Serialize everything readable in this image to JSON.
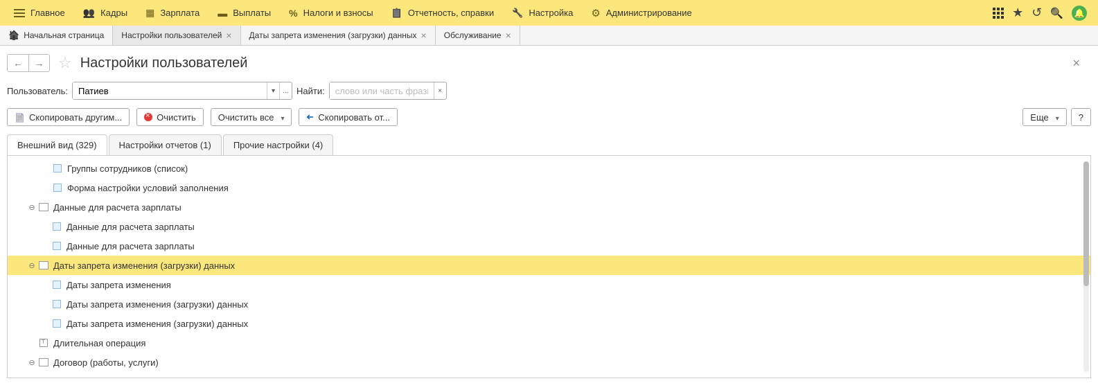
{
  "topMenu": {
    "items": [
      {
        "label": "Главное"
      },
      {
        "label": "Кадры"
      },
      {
        "label": "Зарплата"
      },
      {
        "label": "Выплаты"
      },
      {
        "label": "Налоги и взносы"
      },
      {
        "label": "Отчетность, справки"
      },
      {
        "label": "Настройка"
      },
      {
        "label": "Администрирование"
      }
    ]
  },
  "tabs": [
    {
      "label": "Начальная страница",
      "closeable": false,
      "home": true
    },
    {
      "label": "Настройки пользователей",
      "closeable": true,
      "active": true
    },
    {
      "label": "Даты запрета изменения (загрузки) данных",
      "closeable": true
    },
    {
      "label": "Обслуживание",
      "closeable": true
    }
  ],
  "page": {
    "title": "Настройки пользователей"
  },
  "form": {
    "userLabel": "Пользователь:",
    "userValue": "Патиев",
    "findLabel": "Найти:",
    "findPlaceholder": "слово или часть фразы"
  },
  "toolbar": {
    "copyTo": "Скопировать другим...",
    "clear": "Очистить",
    "clearAll": "Очистить все",
    "copyFrom": "Скопировать от...",
    "more": "Еще",
    "help": "?"
  },
  "subTabs": [
    {
      "label": "Внешний вид (329)",
      "active": true
    },
    {
      "label": "Настройки отчетов (1)"
    },
    {
      "label": "Прочие настройки (4)"
    }
  ],
  "tree": [
    {
      "level": 1,
      "type": "item",
      "label": "Группы сотрудников (список)"
    },
    {
      "level": 1,
      "type": "item",
      "label": "Форма настройки условий заполнения"
    },
    {
      "level": 0,
      "type": "folder",
      "expanded": true,
      "label": "Данные для расчета зарплаты"
    },
    {
      "level": 1,
      "type": "item",
      "label": "Данные для расчета зарплаты"
    },
    {
      "level": 1,
      "type": "item",
      "label": "Данные для расчета зарплаты"
    },
    {
      "level": 0,
      "type": "folder",
      "expanded": true,
      "selected": true,
      "label": "Даты запрета изменения (загрузки) данных"
    },
    {
      "level": 1,
      "type": "item",
      "label": "Даты запрета изменения"
    },
    {
      "level": 1,
      "type": "item",
      "label": "Даты запрета изменения (загрузки) данных"
    },
    {
      "level": 1,
      "type": "item",
      "label": "Даты запрета изменения (загрузки) данных"
    },
    {
      "level": 0,
      "type": "leaf",
      "label": "Длительная операция"
    },
    {
      "level": 0,
      "type": "folder",
      "expanded": true,
      "label": "Договор (работы, услуги)"
    }
  ]
}
